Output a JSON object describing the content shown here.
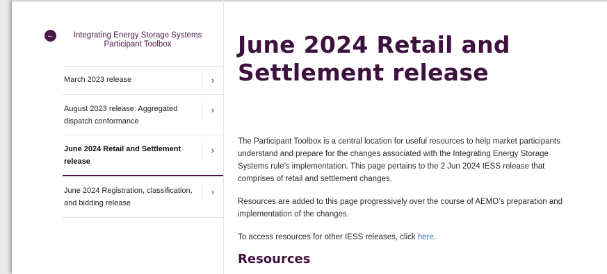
{
  "sidebar": {
    "title_line1": "Integrating Energy Storage Systems",
    "title_line2": "Participant Toolbox",
    "items": [
      {
        "line1": "March 2023 release",
        "line2": ""
      },
      {
        "line1": "August 2023 release: Aggregated",
        "line2": "dispatch conformance"
      },
      {
        "line1": "June 2024 Retail and Settlement",
        "line2": "release"
      },
      {
        "line1": "June 2024 Registration, classification,",
        "line2": "and bidding release"
      }
    ],
    "active_index": 2
  },
  "main": {
    "title_line1": "June 2024 Retail and",
    "title_line2": "Settlement release",
    "para1": [
      "The Participant Toolbox is a central location for useful resources to help market participants",
      "understand and prepare for the changes associated with the Integrating Energy Storage",
      "Systems rule’s implementation. This page pertains to the 2 Jun 2024 IESS release that",
      "comprises of retail and settlement changes."
    ],
    "para2": [
      "Resources are added to this page progressively over the course of AEMO’s preparation and",
      "implementation of the changes."
    ],
    "para3_prefix": "To access resources for other IESS releases, click ",
    "para3_link": "here",
    "para3_suffix": ".",
    "resources_heading": "Resources"
  },
  "colors": {
    "accent": "#4a1746",
    "title": "#3e123e",
    "link": "#2f6fc4"
  },
  "icons": {
    "back": "arrow-left-icon",
    "chevron": "chevron-right-icon"
  }
}
